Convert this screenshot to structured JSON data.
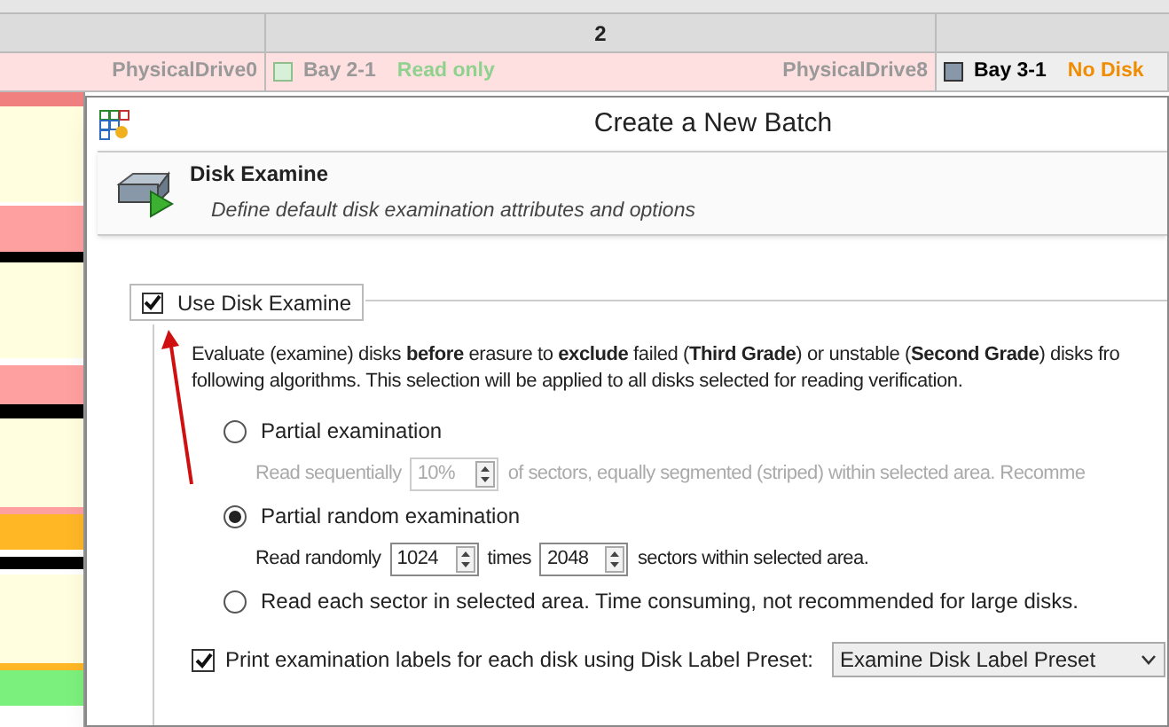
{
  "grid": {
    "column_header": "2",
    "bays": [
      {
        "drive": "PhysicalDrive0"
      },
      {
        "name": "Bay 2-1",
        "status": "Read only",
        "color": "#8fd18f",
        "dimmed": true,
        "drive": "PhysicalDrive8"
      },
      {
        "name": "Bay 3-1",
        "status": "No Disk",
        "color": "#f08c00",
        "dimmed": false
      }
    ]
  },
  "dialog": {
    "title": "Create a New Batch",
    "header": {
      "title": "Disk Examine",
      "subtitle": "Define default disk examination attributes and options"
    },
    "use_checkbox": {
      "label": "Use Disk Examine",
      "checked": true
    },
    "description": [
      "Evaluate (examine) disks **before** erasure to **exclude** failed (**Third Grade**) or unstable (**Second Grade**) disks fro",
      "following algorithms. This selection will be applied to all disks selected for reading verification."
    ],
    "options": [
      {
        "label": "Partial examination",
        "selected": false,
        "detail": [
          {
            "kind": "text",
            "text": "Read sequentially"
          },
          {
            "kind": "spin",
            "value": "10%"
          },
          {
            "kind": "text",
            "text": "of sectors, equally segmented (striped) within selected area. Recomme"
          }
        ]
      },
      {
        "label": "Partial random examination",
        "selected": true,
        "detail": [
          {
            "kind": "text",
            "text": "Read randomly"
          },
          {
            "kind": "spin",
            "value": "1024"
          },
          {
            "kind": "text",
            "text": "times"
          },
          {
            "kind": "spin",
            "value": "2048"
          },
          {
            "kind": "text",
            "text": "sectors within selected area."
          }
        ]
      },
      {
        "label": "Read each sector in selected area. Time consuming, not recommended for large disks.",
        "selected": false
      }
    ],
    "print_labels": {
      "label": "Print examination labels for each disk using Disk Label Preset:",
      "checked": true,
      "preset": "Examine Disk Label Preset"
    }
  }
}
